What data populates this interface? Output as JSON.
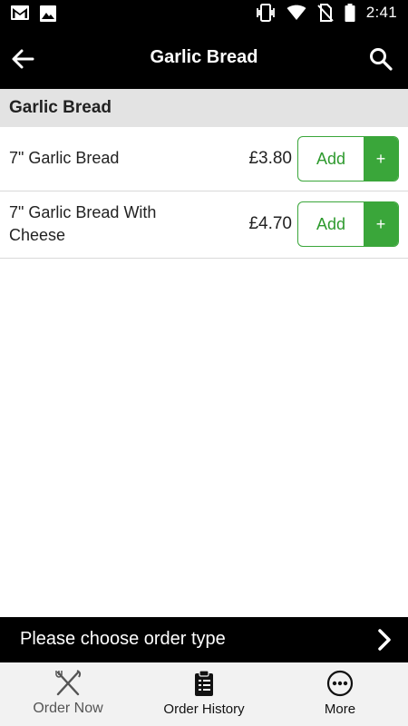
{
  "status_bar": {
    "time": "2:41",
    "icons": [
      "gmail-icon",
      "image-icon",
      "vibrate-icon",
      "wifi-icon",
      "no-sim-icon",
      "battery-icon"
    ]
  },
  "app_bar": {
    "title": "Garlic Bread",
    "back_icon": "arrow-left-icon",
    "search_icon": "search-icon"
  },
  "section": {
    "title": "Garlic Bread"
  },
  "items": [
    {
      "name": "7\" Garlic Bread",
      "price": "£3.80",
      "add_label": "Add",
      "plus_label": "+"
    },
    {
      "name": "7\" Garlic Bread With Cheese",
      "price": "£4.70",
      "add_label": "Add",
      "plus_label": "+"
    }
  ],
  "order_type": {
    "label": "Please choose order type"
  },
  "bottom_nav": {
    "items": [
      {
        "label": "Order Now",
        "icon": "fork-knife-icon"
      },
      {
        "label": "Order History",
        "icon": "clipboard-icon"
      },
      {
        "label": "More",
        "icon": "more-dots-icon"
      }
    ]
  },
  "colors": {
    "accent": "#3aa63a",
    "bar": "#000000",
    "section_bg": "#e3e3e3",
    "nav_bg": "#f2f2f2"
  }
}
